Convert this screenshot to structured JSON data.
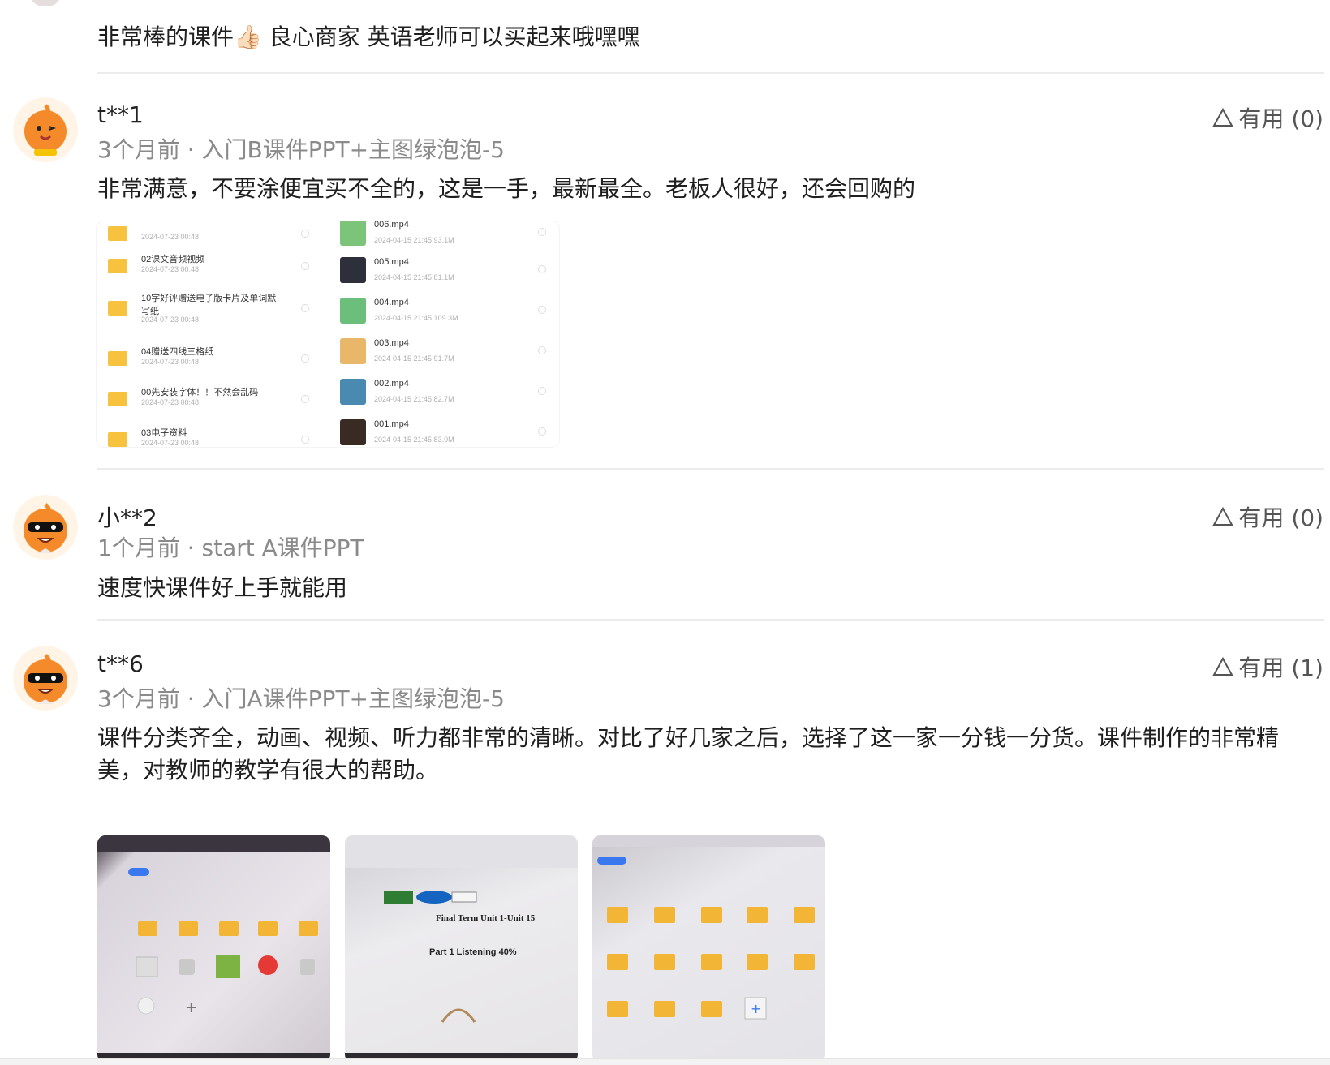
{
  "top_partial": {
    "text": "非常棒的课件👍🏻 良心商家 英语老师可以买起来哦嘿嘿"
  },
  "reviews": [
    {
      "user": "t**1",
      "meta": "3个月前 · 入门B课件PPT+主图绿泡泡-5",
      "useful": "有用 (0)",
      "text": "非常满意，不要涂便宜买不全的，这是一手，最新最全。老板人很好，还会回购的",
      "files_left": [
        {
          "name": "",
          "date": "2024-07-23 00:48"
        },
        {
          "name": "02课文音频视频",
          "date": "2024-07-23 00:48"
        },
        {
          "name": "10字好评赠送电子版卡片及单词默写纸",
          "date": "2024-07-23 00:48"
        },
        {
          "name": "04赠送四线三格纸",
          "date": "2024-07-23 00:48"
        },
        {
          "name": "00先安装字体！！不然会乱码",
          "date": "2024-07-23 00:48"
        },
        {
          "name": "03电子资料",
          "date": "2024-07-23 00:48"
        }
      ],
      "files_right": [
        {
          "name": "006.mp4",
          "date": "2024-04-15 21:45",
          "size": "93.1M"
        },
        {
          "name": "005.mp4",
          "date": "2024-04-15 21:45",
          "size": "81.1M"
        },
        {
          "name": "004.mp4",
          "date": "2024-04-15 21:45",
          "size": "109.3M"
        },
        {
          "name": "003.mp4",
          "date": "2024-04-15 21:45",
          "size": "91.7M"
        },
        {
          "name": "002.mp4",
          "date": "2024-04-15 21:45",
          "size": "82.7M"
        },
        {
          "name": "001.mp4",
          "date": "2024-04-15 21:45",
          "size": "83.0M"
        }
      ]
    },
    {
      "user": "小**2",
      "meta": "1个月前 · start A课件PPT",
      "useful": "有用 (0)",
      "text": "速度快课件好上手就能用"
    },
    {
      "user": "t**6",
      "meta": "3个月前 · 入门A课件PPT+主图绿泡泡-5",
      "useful": "有用 (1)",
      "text": "课件分类齐全，动画、视频、听力都非常的清晰。对比了好几家之后，选择了这一家一分钱一分货。课件制作的非常精美，对教师的教学有很大的帮助。",
      "doc_title": "Final Term Unit 1-Unit 15",
      "doc_part": "Part 1  Listening  40%"
    }
  ],
  "colors": {
    "meta": "#8a8a8a",
    "folder": "#f7c33e",
    "avatar_orange": "#f58a2b"
  }
}
